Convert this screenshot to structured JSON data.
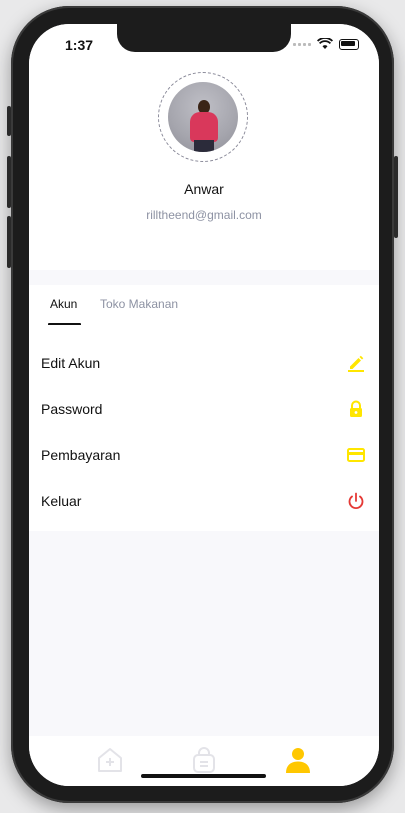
{
  "status_bar": {
    "time": "1:37"
  },
  "profile": {
    "name": "Anwar",
    "email": "rilltheend@gmail.com"
  },
  "tabs": [
    {
      "label": "Akun",
      "active": true
    },
    {
      "label": "Toko Makanan",
      "active": false
    }
  ],
  "menu": {
    "items": [
      {
        "label": "Edit Akun",
        "icon": "edit-icon"
      },
      {
        "label": "Password",
        "icon": "lock-icon"
      },
      {
        "label": "Pembayaran",
        "icon": "credit-card-icon"
      },
      {
        "label": "Keluar",
        "icon": "power-icon"
      }
    ]
  },
  "bottom_nav": [
    {
      "icon": "home-icon",
      "active": false
    },
    {
      "icon": "orders-icon",
      "active": false
    },
    {
      "icon": "profile-icon",
      "active": true
    }
  ],
  "colors": {
    "accent_yellow": "#FFE600",
    "logout_red": "#E53935",
    "nav_active": "#FFC700",
    "nav_inactive": "#E3E3E8",
    "muted_text": "#8D92A3"
  }
}
